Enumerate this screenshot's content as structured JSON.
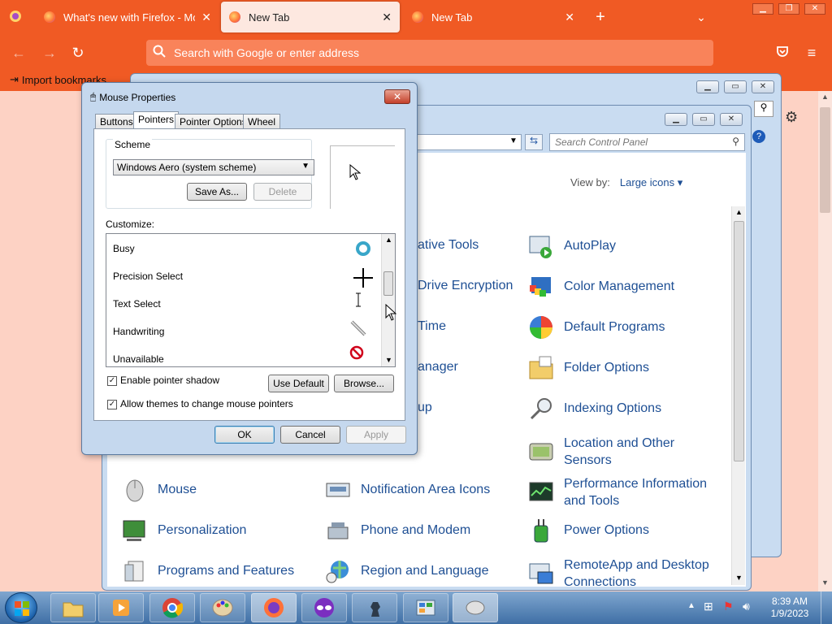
{
  "browser": {
    "tabs": [
      {
        "label": "What's new with Firefox - More"
      },
      {
        "label": "New Tab",
        "active": true
      },
      {
        "label": "New Tab"
      }
    ],
    "address_placeholder": "Search with Google or enter address",
    "bookmarks": {
      "import_label": "Import bookmarks"
    }
  },
  "control_panel": {
    "search_placeholder": "Search Control Panel",
    "view_by_label": "View by:",
    "view_by_value": "Large icons",
    "col_center_items": [
      "ative Tools",
      "Drive Encryption",
      "Time",
      "anager",
      "up",
      "Notification Area Icons",
      "Phone and Modem",
      "Region and Language"
    ],
    "col_right_items": [
      "AutoPlay",
      "Color Management",
      "Default Programs",
      "Folder Options",
      "Indexing Options",
      "Location and Other Sensors",
      "Performance Information and Tools",
      "Power Options",
      "RemoteApp and Desktop Connections"
    ],
    "col_left_items": [
      "Mouse",
      "Personalization",
      "Programs and Features"
    ]
  },
  "dialog": {
    "title": "Mouse Properties",
    "tabs": [
      "Buttons",
      "Pointers",
      "Pointer Options",
      "Wheel"
    ],
    "active_tab": "Pointers",
    "scheme_label": "Scheme",
    "scheme_value": "Windows Aero (system scheme)",
    "save_as": "Save As...",
    "delete": "Delete",
    "customize_label": "Customize:",
    "pointers": [
      "Busy",
      "Precision Select",
      "Text Select",
      "Handwriting",
      "Unavailable"
    ],
    "enable_shadow": "Enable pointer shadow",
    "allow_themes": "Allow themes to change mouse pointers",
    "use_default": "Use Default",
    "browse": "Browse...",
    "ok": "OK",
    "cancel": "Cancel",
    "apply": "Apply"
  },
  "taskbar": {
    "time": "8:39 AM",
    "date": "1/9/2023"
  },
  "colors": {
    "firefox_orange": "#f05a24",
    "link_blue": "#1e4f94"
  }
}
